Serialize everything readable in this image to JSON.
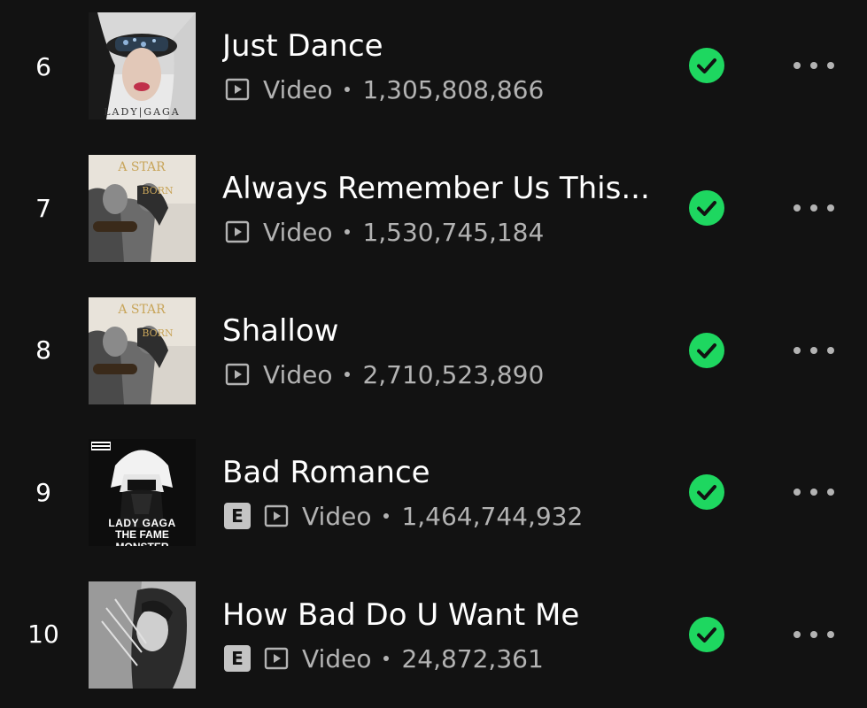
{
  "colors": {
    "background": "#121212",
    "check_green": "#1ed760",
    "secondary_text": "#b3b3b3",
    "explicit_badge": "#c4c4c4"
  },
  "tracks": [
    {
      "rank": "6",
      "title": "Just Dance",
      "explicit": false,
      "type_label": "Video",
      "plays": "1,305,808,866",
      "cover_text": "LADY|GAGA",
      "saved": true
    },
    {
      "rank": "7",
      "title": "Always Remember Us This...",
      "explicit": false,
      "type_label": "Video",
      "plays": "1,530,745,184",
      "cover_text": "A STAR IS BORN",
      "saved": true
    },
    {
      "rank": "8",
      "title": "Shallow",
      "explicit": false,
      "type_label": "Video",
      "plays": "2,710,523,890",
      "cover_text": "A STAR IS BORN",
      "saved": true
    },
    {
      "rank": "9",
      "title": "Bad Romance",
      "explicit": true,
      "explicit_label": "E",
      "type_label": "Video",
      "plays": "1,464,744,932",
      "cover_text_1": "LADY GAGA",
      "cover_text_2": "THE FAME MONSTER",
      "saved": true
    },
    {
      "rank": "10",
      "title": "How Bad Do U Want Me",
      "explicit": true,
      "explicit_label": "E",
      "type_label": "Video",
      "plays": "24,872,361",
      "saved": true
    }
  ],
  "icons": {
    "video": "video-icon",
    "saved": "check-circle-icon",
    "more": "more-horizontal-icon",
    "explicit": "explicit-icon"
  }
}
